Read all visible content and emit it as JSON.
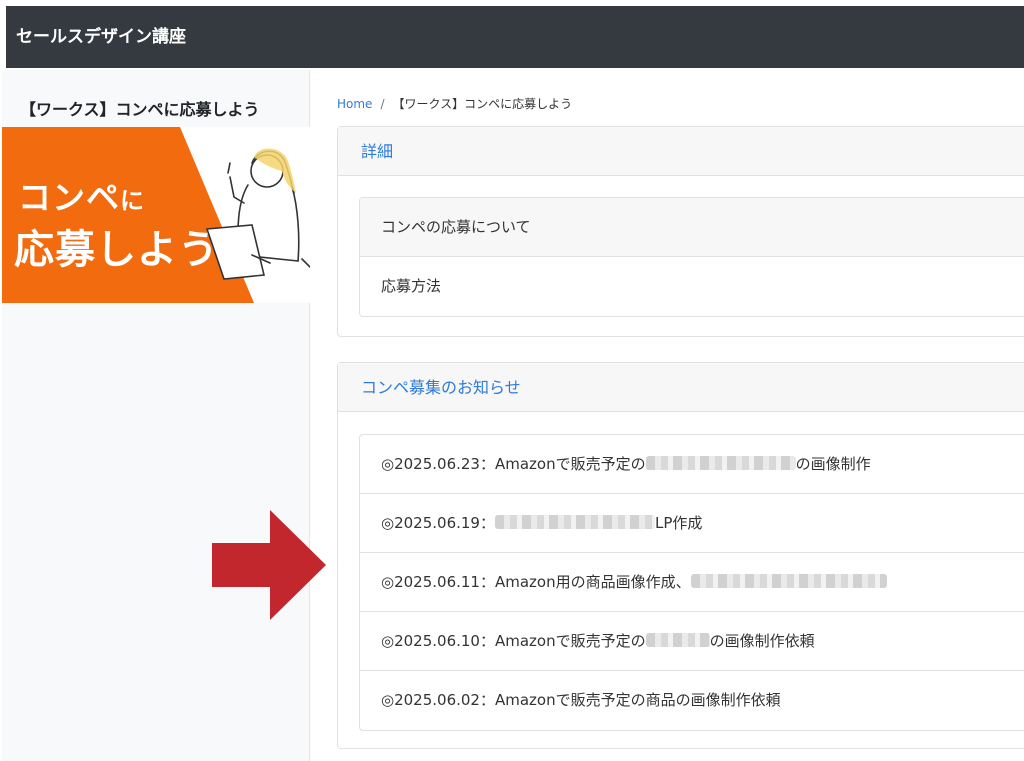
{
  "app": {
    "title": "セールスデザイン講座"
  },
  "sidebar": {
    "title": "【ワークス】コンペに応募しよう",
    "banner": {
      "line1_main": "コンペ",
      "line1_small": "に",
      "line2": "応募しよう"
    },
    "colors": {
      "banner_orange": "#f26b0f"
    }
  },
  "breadcrumb": {
    "home": "Home",
    "separator": "/",
    "current": "【ワークス】コンペに応募しよう"
  },
  "details": {
    "header": "詳細",
    "items": [
      {
        "label": "コンペの応募について"
      },
      {
        "label": "応募方法"
      }
    ]
  },
  "announcements": {
    "header": "コンペ募集のお知らせ",
    "items": [
      {
        "prefix": "◎2025.06.23：Amazonで販売予定の",
        "suffix": "の画像制作"
      },
      {
        "prefix": "◎2025.06.19：",
        "suffix": "LP作成"
      },
      {
        "prefix": "◎2025.06.11：Amazon用の商品画像作成、",
        "suffix": ""
      },
      {
        "prefix": "◎2025.06.10：Amazonで販売予定の",
        "suffix": "の画像制作依頼"
      },
      {
        "prefix": "◎2025.06.02：Amazonで販売予定の商品の画像制作依頼",
        "suffix": ""
      }
    ]
  },
  "overlay": {
    "arrow_icon": "right-arrow-icon",
    "arrow_color": "#c1272d"
  },
  "colors": {
    "topbar": "#343a40",
    "link": "#2f7bd6",
    "sidebar_bg": "#f8f9fa"
  }
}
